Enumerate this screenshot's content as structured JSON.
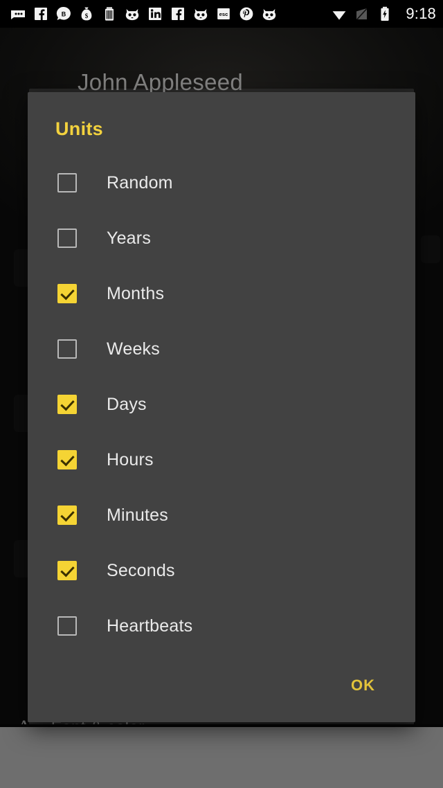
{
  "status_bar": {
    "time": "9:18",
    "notification_icons": [
      {
        "name": "messages-icon",
        "glyph": "chat-bubble"
      },
      {
        "name": "facebook-icon",
        "glyph": "facebook"
      },
      {
        "name": "bitcoin-chat-icon",
        "glyph": "b-bubble"
      },
      {
        "name": "money-bag-icon",
        "glyph": "money-bag"
      },
      {
        "name": "battery-app-icon",
        "glyph": "battery-app"
      },
      {
        "name": "cat-app-icon",
        "glyph": "cat"
      },
      {
        "name": "linkedin-icon",
        "glyph": "linkedin"
      },
      {
        "name": "facebook-icon-2",
        "glyph": "facebook"
      },
      {
        "name": "cat-app-icon-2",
        "glyph": "cat"
      },
      {
        "name": "esc-app-icon",
        "glyph": "esc"
      },
      {
        "name": "pinterest-icon",
        "glyph": "pinterest"
      },
      {
        "name": "cat-app-icon-3",
        "glyph": "cat"
      }
    ],
    "system_icons": [
      {
        "name": "wifi-icon",
        "glyph": "wifi"
      },
      {
        "name": "signal-icon",
        "glyph": "signal-off"
      },
      {
        "name": "battery-charging-icon",
        "glyph": "battery-charging"
      }
    ]
  },
  "background": {
    "profile_name": "John Appleseed",
    "font_color_label": "Font & color",
    "font_icon": "A"
  },
  "dialog": {
    "title": "Units",
    "ok_label": "OK",
    "units": [
      {
        "label": "Random",
        "checked": false
      },
      {
        "label": "Years",
        "checked": false
      },
      {
        "label": "Months",
        "checked": true
      },
      {
        "label": "Weeks",
        "checked": false
      },
      {
        "label": "Days",
        "checked": true
      },
      {
        "label": "Hours",
        "checked": true
      },
      {
        "label": "Minutes",
        "checked": true
      },
      {
        "label": "Seconds",
        "checked": true
      },
      {
        "label": "Heartbeats",
        "checked": false
      }
    ]
  },
  "colors": {
    "accent_yellow": "#f5d434",
    "title_yellow": "#f3d23e",
    "dialog_bg": "#424242",
    "text_primary": "#eaeaea",
    "navbar": "#6e6e6e"
  }
}
